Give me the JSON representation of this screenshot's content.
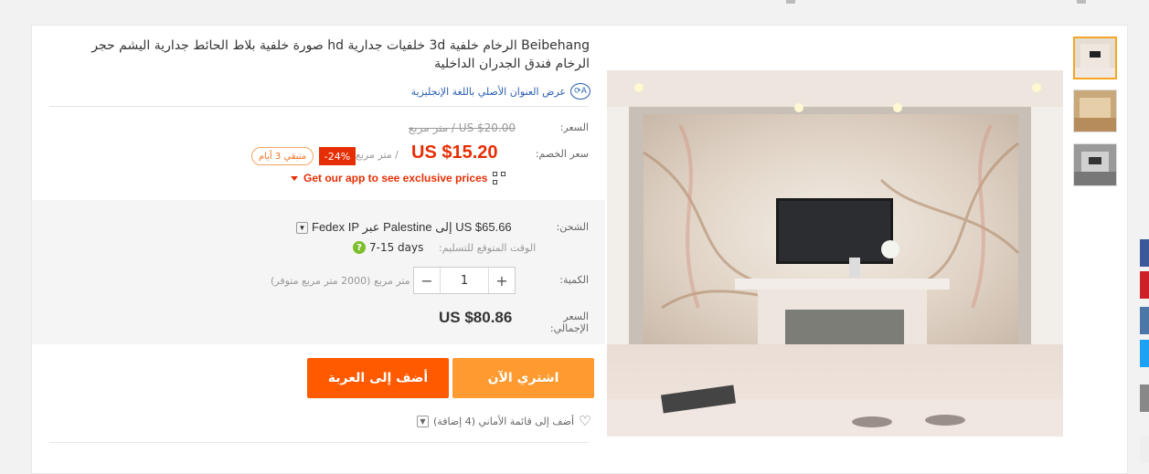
{
  "product": {
    "title": "Beibehang الرخام خلفية 3d خلفيات جدارية hd صورة خلفية بلاط الحائط جدارية اليشم حجر الرخام فندق الجدران الداخلية",
    "show_original_title": "عرض العنوان الأصلي باللغة الإنجليزية",
    "translate_icon": "translate-icon"
  },
  "pricing": {
    "price_label": "السعر:",
    "original_price": "US $20.00 / متر مربع",
    "discount_label": "سعر الخصم:",
    "discount_price": "US $15.20",
    "unit": "/ متر مربع",
    "discount_badge": "-24%",
    "days_left": "متبقي 3 أيام",
    "app_prompt": "Get our app to see exclusive prices"
  },
  "shipping": {
    "label": "الشحن:",
    "text": "US $65.66 إلى Palestine عبر Fedex IP",
    "eta_label": "الوقت المتوقع للتسليم:",
    "eta": "7-15 days"
  },
  "quantity": {
    "label": "الكمية:",
    "value": "1",
    "minus": "−",
    "plus": "+",
    "available": "متر مربع (2000 متر مربع متوفر)"
  },
  "total": {
    "label": "السعر الإجمالي:",
    "value": "US $80.86"
  },
  "actions": {
    "buy_now": "اشتري الآن",
    "add_to_cart": "أضف إلى العربة",
    "wishlist": "أضف إلى قائمة الأماني (4 إضافة)"
  },
  "colors": {
    "accent": "#e62e04",
    "buy": "#ff9a30",
    "cart": "#ff5a00",
    "link": "#2a5fb0"
  }
}
